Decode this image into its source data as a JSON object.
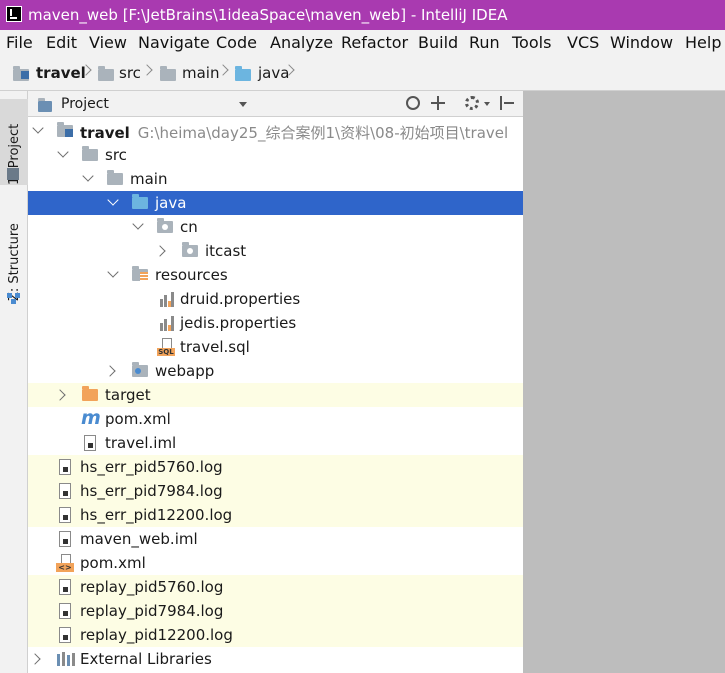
{
  "window": {
    "title": "maven_web [F:\\JetBrains\\1ideaSpace\\maven_web] - IntelliJ IDEA"
  },
  "menu": [
    "File",
    "Edit",
    "View",
    "Navigate",
    "Code",
    "Analyze",
    "Refactor",
    "Build",
    "Run",
    "Tools",
    "VCS",
    "Window",
    "Help"
  ],
  "breadcrumbs": [
    "travel",
    "src",
    "main",
    "java"
  ],
  "sidebar": {
    "tab_project": "1: Project",
    "tab_structure": "Z: Structure"
  },
  "panel": {
    "title": "Project"
  },
  "tree": {
    "root_label": "travel",
    "root_path": "G:\\heima\\day25_综合案例1\\资料\\08-初始项目\\travel",
    "src": "src",
    "main": "main",
    "java": "java",
    "cn": "cn",
    "itcast": "itcast",
    "resources": "resources",
    "druid": "druid.properties",
    "jedis": "jedis.properties",
    "travel_sql": "travel.sql",
    "webapp": "webapp",
    "target": "target",
    "pom_inner": "pom.xml",
    "travel_iml": "travel.iml",
    "root_files": [
      "hs_err_pid5760.log",
      "hs_err_pid7984.log",
      "hs_err_pid12200.log",
      "maven_web.iml",
      "pom.xml",
      "replay_pid5760.log",
      "replay_pid7984.log",
      "replay_pid12200.log"
    ],
    "external": "External Libraries"
  },
  "colors": {
    "title_bar": "#a93ab0",
    "selection": "#2f65ca",
    "excluded_bg": "#fdfde4",
    "folder_blue": "#6cb5e0",
    "folder_orange": "#f2a35a"
  },
  "icons": [
    "intellij-icon",
    "folder-icon",
    "module-folder-icon",
    "source-folder-icon",
    "package-icon",
    "resources-folder-icon",
    "properties-file-icon",
    "sql-file-icon",
    "maven-icon",
    "xml-file-icon",
    "iml-file-icon",
    "log-file-icon",
    "external-libraries-icon",
    "crosshair-icon",
    "collapse-all-icon",
    "gear-icon",
    "hide-icon",
    "chevron-down-icon"
  ]
}
